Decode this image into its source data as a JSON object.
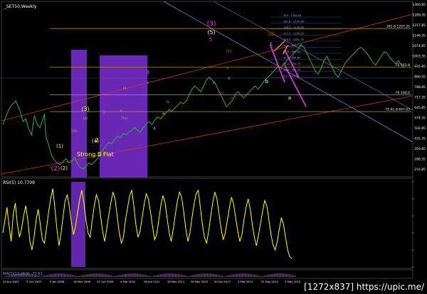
{
  "window": {
    "title": "_SET50,Weekly",
    "indicator_label": "RSI(5) 10.7709",
    "indicator_bottom_label": "MACD(12,26,9) -73.61",
    "watermark": "[1272x837] https://upic.me/"
  },
  "chart_data": [
    {
      "type": "line",
      "title": "_SET50,Weekly",
      "x_ticks": [
        "24 Jun 2007",
        "5 Oct 2007",
        "5 Jan 2008",
        "16 Mar 2009",
        "25 Oct 2009",
        "4 Feb 2010",
        "16 Jun 2011",
        "18 Nov 2011",
        "30 Nov 2012",
        "20 Jun 2013",
        "3 Feb 2014",
        "21 Sep 2014",
        "3 May 2015"
      ],
      "y_ticks": [
        "1360.85",
        "1289.35",
        "1217.85",
        "1146.35",
        "1074.85",
        "1003.35",
        "931.85",
        "860.35",
        "788.85",
        "717.35",
        "645.85",
        "574.35",
        "502.85",
        "431.35",
        "359.85",
        "288.35",
        "216.85"
      ],
      "ylim": [
        216.85,
        1380
      ],
      "price_series": [
        {
          "x": 0,
          "y": 560
        },
        {
          "x": 4,
          "y": 660
        },
        {
          "x": 6,
          "y": 690
        },
        {
          "x": 9,
          "y": 720
        },
        {
          "x": 12,
          "y": 650
        },
        {
          "x": 14,
          "y": 580
        },
        {
          "x": 16,
          "y": 600
        },
        {
          "x": 18,
          "y": 530
        },
        {
          "x": 20,
          "y": 490
        },
        {
          "x": 22,
          "y": 620
        },
        {
          "x": 24,
          "y": 560
        },
        {
          "x": 26,
          "y": 540
        },
        {
          "x": 28,
          "y": 600
        },
        {
          "x": 29,
          "y": 630
        },
        {
          "x": 30,
          "y": 480
        },
        {
          "x": 32,
          "y": 420
        },
        {
          "x": 34,
          "y": 350
        },
        {
          "x": 36,
          "y": 320
        },
        {
          "x": 38,
          "y": 300
        },
        {
          "x": 40,
          "y": 290
        },
        {
          "x": 42,
          "y": 310
        },
        {
          "x": 44,
          "y": 330
        },
        {
          "x": 46,
          "y": 300
        },
        {
          "x": 48,
          "y": 310
        },
        {
          "x": 50,
          "y": 340
        },
        {
          "x": 52,
          "y": 300
        },
        {
          "x": 54,
          "y": 270
        },
        {
          "x": 56,
          "y": 260
        },
        {
          "x": 58,
          "y": 280
        },
        {
          "x": 60,
          "y": 300
        },
        {
          "x": 62,
          "y": 290
        },
        {
          "x": 64,
          "y": 310
        },
        {
          "x": 66,
          "y": 330
        },
        {
          "x": 68,
          "y": 360
        },
        {
          "x": 70,
          "y": 390
        },
        {
          "x": 72,
          "y": 420
        },
        {
          "x": 74,
          "y": 440
        },
        {
          "x": 76,
          "y": 430
        },
        {
          "x": 78,
          "y": 460
        },
        {
          "x": 80,
          "y": 480
        },
        {
          "x": 82,
          "y": 470
        },
        {
          "x": 84,
          "y": 500
        },
        {
          "x": 86,
          "y": 490
        },
        {
          "x": 88,
          "y": 510
        },
        {
          "x": 90,
          "y": 520
        },
        {
          "x": 92,
          "y": 540
        },
        {
          "x": 94,
          "y": 520
        },
        {
          "x": 96,
          "y": 510
        },
        {
          "x": 98,
          "y": 540
        },
        {
          "x": 100,
          "y": 560
        },
        {
          "x": 102,
          "y": 580
        },
        {
          "x": 104,
          "y": 560
        },
        {
          "x": 106,
          "y": 590
        },
        {
          "x": 108,
          "y": 610
        },
        {
          "x": 110,
          "y": 600
        },
        {
          "x": 112,
          "y": 620
        },
        {
          "x": 114,
          "y": 640
        },
        {
          "x": 116,
          "y": 660
        },
        {
          "x": 118,
          "y": 650
        },
        {
          "x": 120,
          "y": 670
        },
        {
          "x": 122,
          "y": 690
        },
        {
          "x": 124,
          "y": 710
        },
        {
          "x": 126,
          "y": 700
        },
        {
          "x": 128,
          "y": 720
        },
        {
          "x": 130,
          "y": 760
        },
        {
          "x": 132,
          "y": 800
        },
        {
          "x": 134,
          "y": 820
        },
        {
          "x": 136,
          "y": 800
        },
        {
          "x": 138,
          "y": 780
        },
        {
          "x": 140,
          "y": 820
        },
        {
          "x": 142,
          "y": 860
        },
        {
          "x": 144,
          "y": 880
        },
        {
          "x": 146,
          "y": 860
        },
        {
          "x": 148,
          "y": 840
        },
        {
          "x": 150,
          "y": 800
        },
        {
          "x": 152,
          "y": 760
        },
        {
          "x": 154,
          "y": 720
        },
        {
          "x": 156,
          "y": 680
        },
        {
          "x": 158,
          "y": 700
        },
        {
          "x": 160,
          "y": 720
        },
        {
          "x": 162,
          "y": 760
        },
        {
          "x": 164,
          "y": 780
        },
        {
          "x": 166,
          "y": 760
        },
        {
          "x": 168,
          "y": 740
        },
        {
          "x": 170,
          "y": 760
        },
        {
          "x": 172,
          "y": 780
        },
        {
          "x": 174,
          "y": 800
        },
        {
          "x": 176,
          "y": 820
        },
        {
          "x": 178,
          "y": 800
        },
        {
          "x": 180,
          "y": 820
        },
        {
          "x": 182,
          "y": 850
        },
        {
          "x": 184,
          "y": 870
        },
        {
          "x": 186,
          "y": 890
        },
        {
          "x": 188,
          "y": 910
        },
        {
          "x": 190,
          "y": 930
        },
        {
          "x": 192,
          "y": 950
        },
        {
          "x": 194,
          "y": 940
        },
        {
          "x": 196,
          "y": 970
        },
        {
          "x": 198,
          "y": 990
        },
        {
          "x": 200,
          "y": 1010
        },
        {
          "x": 202,
          "y": 1030
        },
        {
          "x": 204,
          "y": 1050
        },
        {
          "x": 206,
          "y": 1070
        },
        {
          "x": 208,
          "y": 1100
        },
        {
          "x": 210,
          "y": 1080
        },
        {
          "x": 212,
          "y": 1040
        },
        {
          "x": 214,
          "y": 1000
        },
        {
          "x": 216,
          "y": 960
        },
        {
          "x": 218,
          "y": 920
        },
        {
          "x": 220,
          "y": 900
        },
        {
          "x": 222,
          "y": 940
        },
        {
          "x": 224,
          "y": 990
        },
        {
          "x": 226,
          "y": 1020
        },
        {
          "x": 228,
          "y": 980
        },
        {
          "x": 230,
          "y": 940
        },
        {
          "x": 232,
          "y": 900
        },
        {
          "x": 234,
          "y": 880
        },
        {
          "x": 236,
          "y": 920
        },
        {
          "x": 238,
          "y": 960
        },
        {
          "x": 240,
          "y": 990
        },
        {
          "x": 242,
          "y": 1010
        },
        {
          "x": 244,
          "y": 1030
        },
        {
          "x": 246,
          "y": 1050
        },
        {
          "x": 248,
          "y": 1070
        },
        {
          "x": 250,
          "y": 1080
        },
        {
          "x": 252,
          "y": 1060
        },
        {
          "x": 254,
          "y": 1040
        },
        {
          "x": 256,
          "y": 1010
        },
        {
          "x": 258,
          "y": 980
        },
        {
          "x": 260,
          "y": 960
        },
        {
          "x": 262,
          "y": 990
        },
        {
          "x": 264,
          "y": 1020
        },
        {
          "x": 266,
          "y": 1050
        },
        {
          "x": 268,
          "y": 1040
        },
        {
          "x": 270,
          "y": 1010
        },
        {
          "x": 272,
          "y": 990
        },
        {
          "x": 274,
          "y": 970
        },
        {
          "x": 276,
          "y": 990
        },
        {
          "x": 278,
          "y": 960
        },
        {
          "x": 280,
          "y": 940
        }
      ],
      "horizontal_levels": [
        {
          "label": "261.8 1207.25",
          "y": 1207.25,
          "color": "#c8a000"
        },
        {
          "label": "FE 161.8",
          "y": 946,
          "color": "#c8a000"
        },
        {
          "label": "FE 100.0",
          "y": 760,
          "color": "#c8a000"
        },
        {
          "label": "FE 61.8 647.03",
          "y": 647,
          "color": "#c8a000"
        }
      ],
      "small_fib_levels": [
        "200 - 1334.40",
        "161.8 - 1237.26",
        "138.2 - 1178.26",
        "127.2 - 1150.35",
        "100.0 - 1081.76",
        "76.4 - 1027.73",
        "61.8 - 984.64",
        "50.0 - 964.87",
        "38.2 - 931.73",
        "23.6 - 901.21",
        "0.0 - 829.13"
      ],
      "wave_labels": {
        "major": [
          "(3)",
          "(5)",
          "(2)",
          "2",
          "4"
        ],
        "minor": [
          "(1)",
          "(2)",
          "(3)",
          "(4)",
          "1",
          "(iii)",
          "(v)",
          "(iv)",
          "iii",
          "iv",
          "v",
          "ii",
          "5",
          "3"
        ],
        "corrective": [
          "a",
          "b",
          "c",
          "(a)",
          "(b)",
          "(c)",
          "(d)",
          "a",
          "b",
          "c"
        ],
        "annotation": "Strong B Flat"
      }
    },
    {
      "type": "line",
      "title": "RSI(5) 10.7709",
      "ylim": [
        0,
        100
      ],
      "series_values": [
        40,
        55,
        70,
        48,
        30,
        62,
        75,
        50,
        35,
        45,
        60,
        72,
        55,
        30,
        20,
        35,
        55,
        68,
        50,
        32,
        28,
        45,
        65,
        80,
        92,
        70,
        45,
        25,
        40,
        60,
        78,
        85,
        70,
        52,
        38,
        48,
        65,
        80,
        90,
        75,
        55,
        40,
        35,
        55,
        72,
        85,
        78,
        60,
        42,
        30,
        45,
        62,
        76,
        88,
        80,
        60,
        40,
        28,
        35,
        55,
        70,
        84,
        90,
        72,
        50,
        35,
        42,
        58,
        74,
        86,
        80,
        65,
        48,
        32,
        38,
        55,
        72,
        84,
        76,
        58,
        40,
        30,
        45,
        62,
        78,
        88,
        82,
        65,
        45,
        30,
        40,
        58,
        74,
        86,
        90,
        70,
        50,
        35,
        28,
        42,
        60,
        76,
        88,
        80,
        62,
        45,
        32,
        40,
        55,
        70,
        82,
        74,
        58,
        42,
        30,
        38,
        55,
        70,
        80,
        68,
        50,
        35,
        25,
        38,
        52,
        66,
        78,
        72,
        55,
        38,
        26,
        20,
        30,
        45,
        58,
        50,
        35,
        20,
        12,
        10
      ]
    }
  ],
  "colors": {
    "background": "#000000",
    "price_line": "#22b14c",
    "rsi_line": "#ffff00",
    "purple_block": "#7b2fd4",
    "level_gold": "#c8a000",
    "channel_red": "#c83a1e",
    "channel_blue": "#7b7bd0",
    "magenta": "#ff30ff",
    "yellow_text": "#ffff40",
    "orange": "#ff7f27",
    "white_text": "#ffffff"
  }
}
